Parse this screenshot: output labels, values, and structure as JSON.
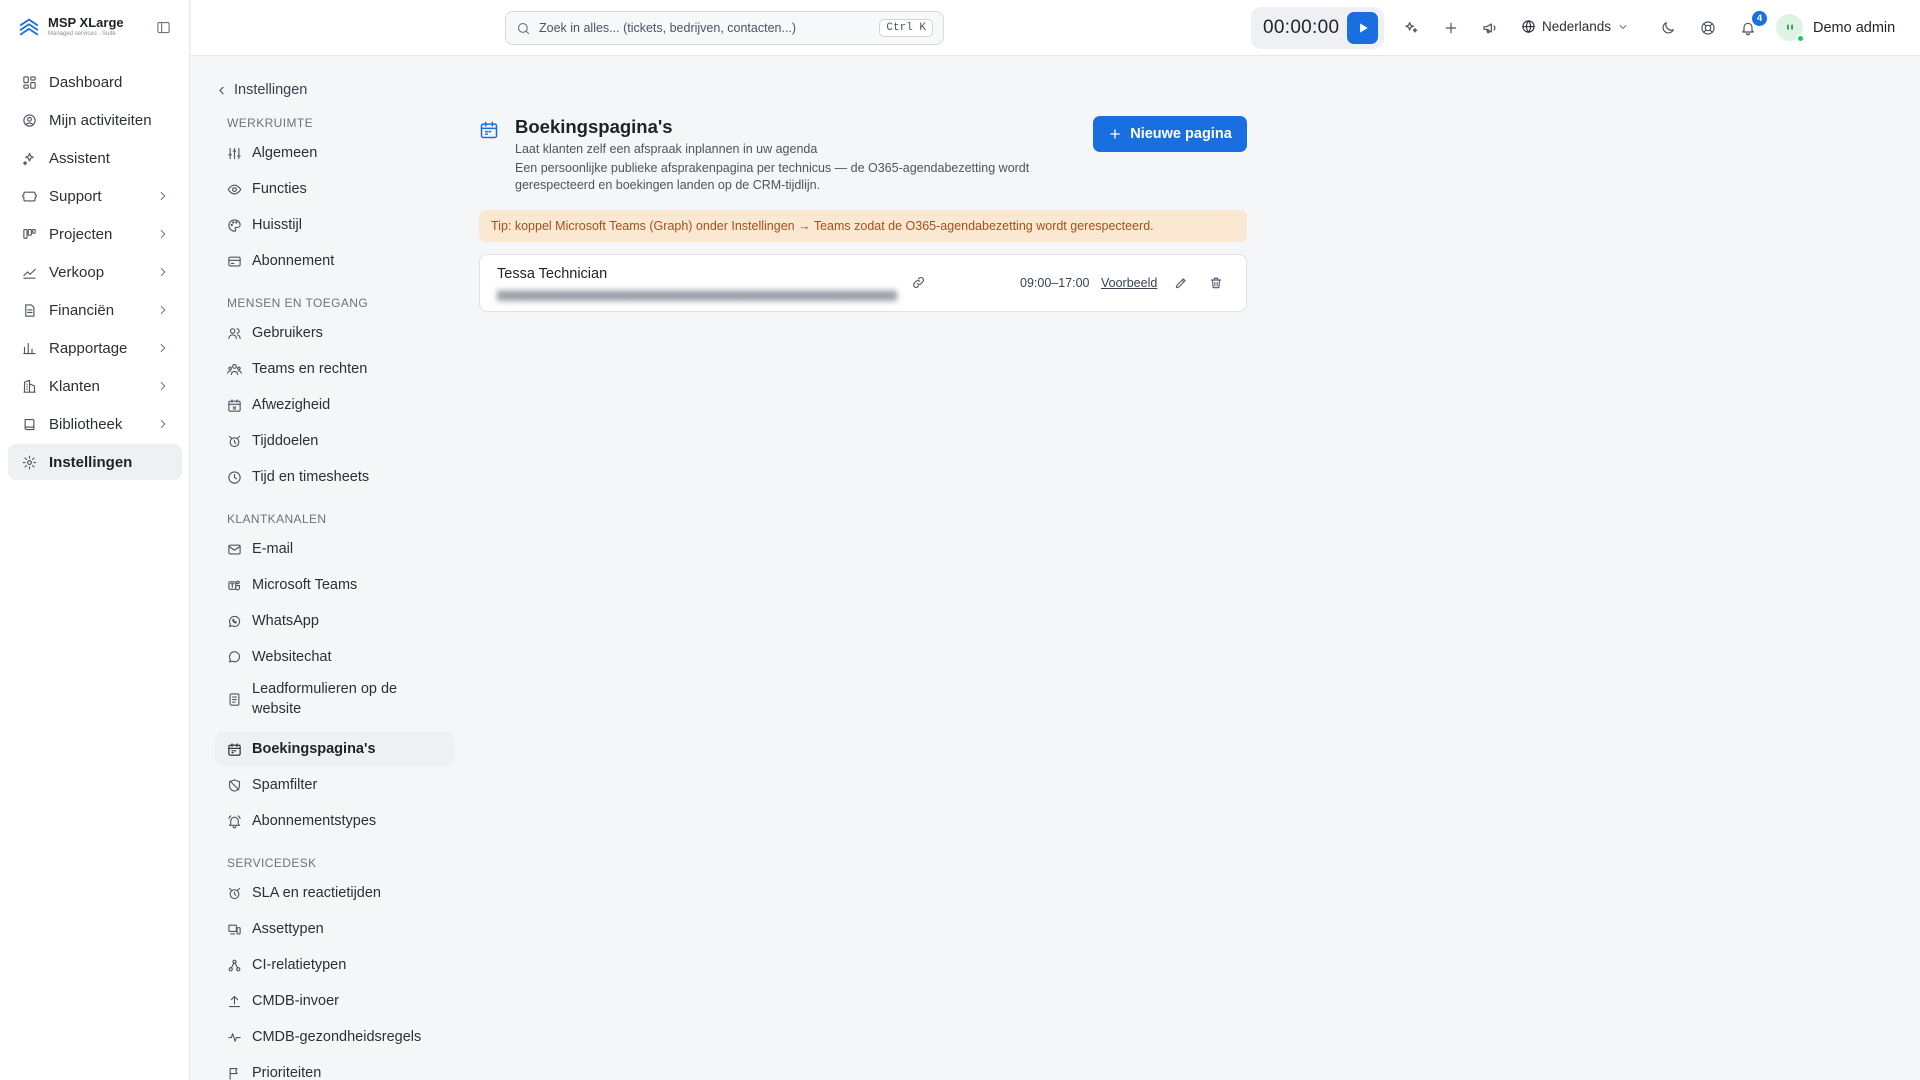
{
  "brand": {
    "name": "MSP XLarge",
    "tagline": "Managed services · Suite",
    "color": "#1a6fe0"
  },
  "main_nav": [
    {
      "label": "Dashboard",
      "icon": "dashboard-icon",
      "expandable": false
    },
    {
      "label": "Mijn activiteiten",
      "icon": "user-circle-icon",
      "expandable": false
    },
    {
      "label": "Assistent",
      "icon": "sparkles-icon",
      "expandable": false
    },
    {
      "label": "Support",
      "icon": "ticket-icon",
      "expandable": true
    },
    {
      "label": "Projecten",
      "icon": "kanban-icon",
      "expandable": true
    },
    {
      "label": "Verkoop",
      "icon": "trend-icon",
      "expandable": true
    },
    {
      "label": "Financiën",
      "icon": "invoice-icon",
      "expandable": true
    },
    {
      "label": "Rapportage",
      "icon": "bar-chart-icon",
      "expandable": true
    },
    {
      "label": "Klanten",
      "icon": "building-icon",
      "expandable": true
    },
    {
      "label": "Bibliotheek",
      "icon": "book-icon",
      "expandable": true
    },
    {
      "label": "Instellingen",
      "icon": "gear-icon",
      "expandable": false,
      "active": true
    }
  ],
  "topbar": {
    "search_placeholder": "Zoek in alles... (tickets, bedrijven, contacten...)",
    "search_shortcut": "Ctrl K",
    "timer": "00:00:00",
    "language": "Nederlands",
    "notification_count": "4",
    "user_name": "Demo admin"
  },
  "settings_nav": {
    "back_label": "Instellingen",
    "sections": [
      {
        "title": "WERKRUIMTE",
        "items": [
          {
            "label": "Algemeen",
            "icon": "sliders-icon"
          },
          {
            "label": "Functies",
            "icon": "eye-icon"
          },
          {
            "label": "Huisstijl",
            "icon": "palette-icon"
          },
          {
            "label": "Abonnement",
            "icon": "credit-card-icon"
          }
        ]
      },
      {
        "title": "MENSEN EN TOEGANG",
        "items": [
          {
            "label": "Gebruikers",
            "icon": "users-icon"
          },
          {
            "label": "Teams en rechten",
            "icon": "team-icon"
          },
          {
            "label": "Afwezigheid",
            "icon": "calendar-x-icon"
          },
          {
            "label": "Tijddoelen",
            "icon": "alarm-icon"
          },
          {
            "label": "Tijd en timesheets",
            "icon": "clock-icon"
          }
        ]
      },
      {
        "title": "KLANTKANALEN",
        "items": [
          {
            "label": "E-mail",
            "icon": "mail-icon"
          },
          {
            "label": "Microsoft Teams",
            "icon": "teams-icon"
          },
          {
            "label": "WhatsApp",
            "icon": "whatsapp-icon"
          },
          {
            "label": "Websitechat",
            "icon": "chat-icon"
          },
          {
            "label": "Leadformulieren op de website",
            "icon": "form-icon"
          },
          {
            "label": "Boekingspagina's",
            "icon": "calendar-icon",
            "active": true
          },
          {
            "label": "Spamfilter",
            "icon": "spam-icon"
          },
          {
            "label": "Abonnementstypes",
            "icon": "bell-ring-icon"
          }
        ]
      },
      {
        "title": "SERVICEDESK",
        "items": [
          {
            "label": "SLA en reactietijden",
            "icon": "alarm-icon"
          },
          {
            "label": "Assettypen",
            "icon": "assets-icon"
          },
          {
            "label": "CI-relatietypen",
            "icon": "network-icon"
          },
          {
            "label": "CMDB-invoer",
            "icon": "upload-icon"
          },
          {
            "label": "CMDB-gezondheidsregels",
            "icon": "pulse-icon"
          },
          {
            "label": "Prioriteiten",
            "icon": "flag-icon"
          }
        ]
      }
    ]
  },
  "page": {
    "title": "Boekingspagina's",
    "subtitle": "Laat klanten zelf een afspraak inplannen in uw agenda",
    "description": "Een persoonlijke publieke afsprakenpagina per technicus — de O365-agendabezetting wordt gerespecteerd en boekingen landen op de CRM-tijdlijn.",
    "new_button": "Nieuwe pagina",
    "tip": "Tip: koppel Microsoft Teams (Graph) onder Instellingen → Teams zodat de O365-agendabezetting wordt gerespecteerd.",
    "booking_pages": [
      {
        "name": "Tessa Technician",
        "hours": "09:00–17:00",
        "preview_label": "Voorbeeld"
      }
    ]
  },
  "colors": {
    "accent": "#1a6fe0",
    "tip_bg": "#fbe8d2",
    "tip_text": "#a5521a",
    "online": "#22c55e"
  }
}
